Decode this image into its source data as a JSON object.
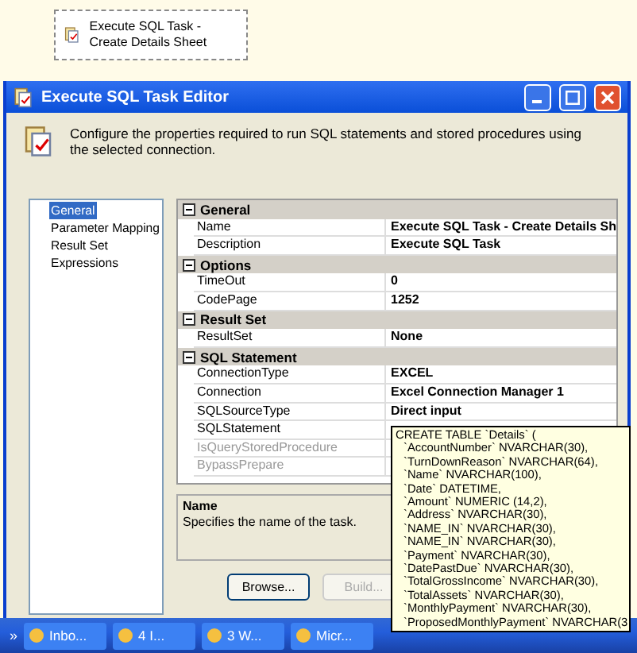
{
  "canvas": {
    "task": {
      "label": "Execute SQL Task - Create Details Sheet",
      "selected": true
    }
  },
  "window": {
    "title": "Execute SQL Task Editor",
    "description": "Configure the properties required to run SQL statements and stored procedures using the selected connection."
  },
  "sidebar": {
    "items": [
      {
        "label": "General",
        "selected": true
      },
      {
        "label": "Parameter Mapping",
        "selected": false
      },
      {
        "label": "Result Set",
        "selected": false
      },
      {
        "label": "Expressions",
        "selected": false
      }
    ]
  },
  "grid": {
    "categories": [
      {
        "title": "General",
        "expanded": true,
        "properties": [
          {
            "name": "Name",
            "value": "Execute SQL Task - Create Details Sh",
            "disabled": false
          },
          {
            "name": "Description",
            "value": "Execute SQL Task",
            "disabled": false
          }
        ]
      },
      {
        "title": "Options",
        "expanded": true,
        "properties": [
          {
            "name": "TimeOut",
            "value": "0",
            "disabled": false
          },
          {
            "name": "CodePage",
            "value": "1252",
            "disabled": false
          }
        ]
      },
      {
        "title": "Result Set",
        "expanded": true,
        "properties": [
          {
            "name": "ResultSet",
            "value": "None",
            "disabled": false
          }
        ]
      },
      {
        "title": "SQL Statement",
        "expanded": true,
        "properties": [
          {
            "name": "ConnectionType",
            "value": "EXCEL",
            "disabled": false
          },
          {
            "name": "Connection",
            "value": "Excel Connection Manager 1",
            "disabled": false
          },
          {
            "name": "SQLSourceType",
            "value": "Direct input",
            "disabled": false
          },
          {
            "name": "SQLStatement",
            "disabled": false
          },
          {
            "name": "IsQueryStoredProcedure",
            "disabled": true
          },
          {
            "name": "BypassPrepare",
            "disabled": true
          }
        ]
      }
    ]
  },
  "help": {
    "title": "Name",
    "text": "Specifies the name of the task."
  },
  "buttons": [
    {
      "label": "Browse...",
      "disabled": false
    },
    {
      "label": "Build...",
      "disabled": true
    }
  ],
  "tooltip": {
    "lines": [
      "CREATE TABLE `Details` (",
      "`AccountNumber` NVARCHAR(30),",
      "`TurnDownReason` NVARCHAR(64),",
      "`Name` NVARCHAR(100),",
      "`Date` DATETIME,",
      "`Amount` NUMERIC (14,2),",
      "`Address` NVARCHAR(30),",
      "`NAME_IN` NVARCHAR(30),",
      "`NAME_IN` NVARCHAR(30),",
      "`Payment` NVARCHAR(30),",
      "`DatePastDue` NVARCHAR(30),",
      "`TotalGrossIncome` NVARCHAR(30),",
      "`TotalAssets` NVARCHAR(30),",
      "`MonthlyPayment` NVARCHAR(30),",
      "`ProposedMonthlyPayment` NVARCHAR(3"
    ]
  },
  "taskbar": {
    "overflow": "»",
    "items": [
      {
        "label": "Inbo..."
      },
      {
        "label": "4 I..."
      },
      {
        "label": "3 W..."
      },
      {
        "label": "Micr..."
      }
    ]
  }
}
